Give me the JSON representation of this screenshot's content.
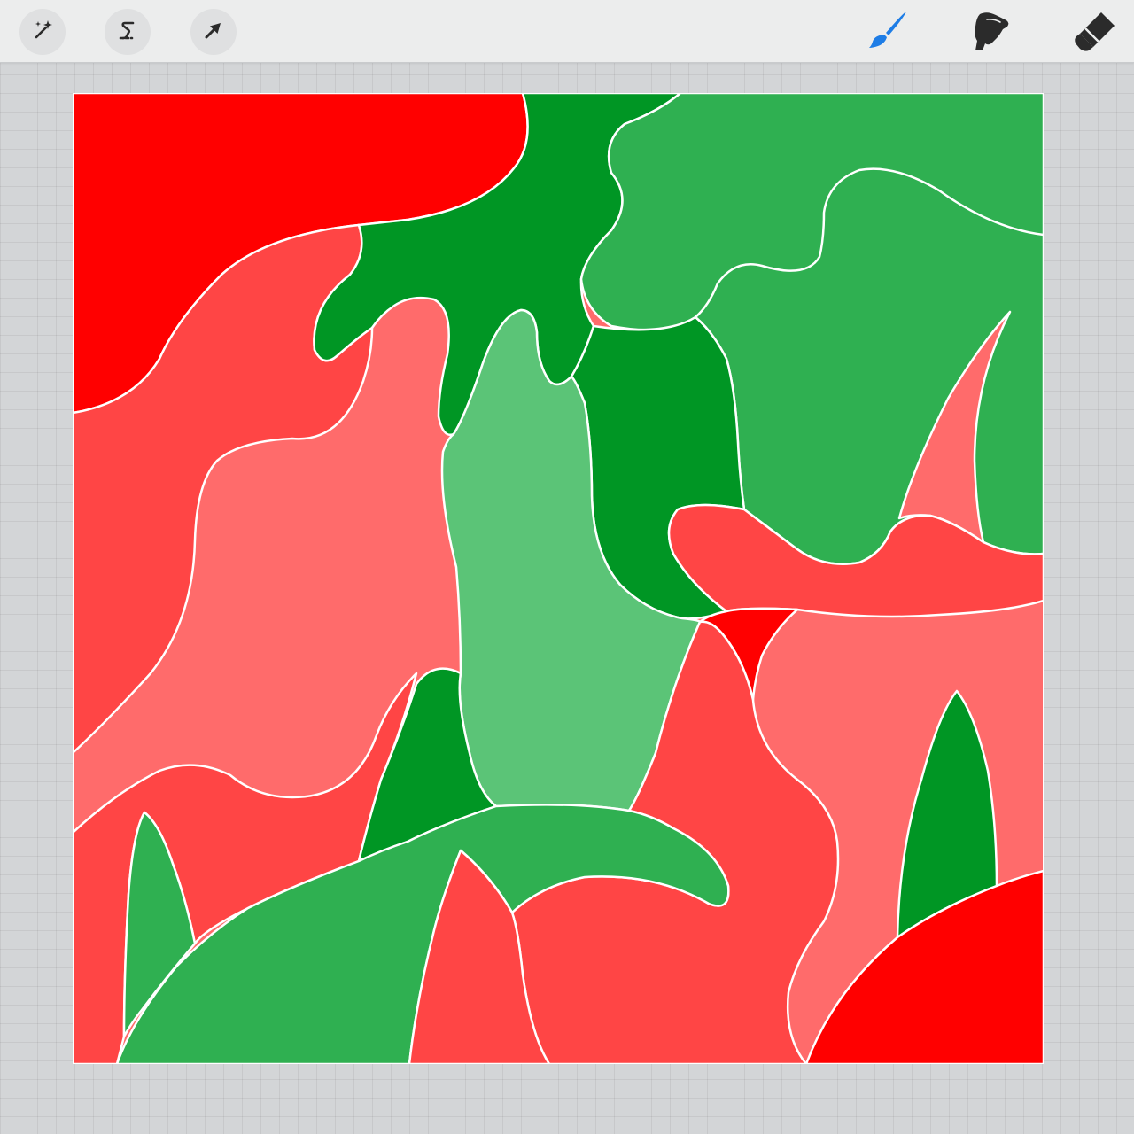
{
  "app": {
    "toolbar": {
      "left_tools": [
        {
          "id": "adjustments",
          "icon": "magic-wand-icon",
          "active": false
        },
        {
          "id": "selection",
          "icon": "selection-s-icon",
          "active": false
        },
        {
          "id": "transform",
          "icon": "arrow-cursor-icon",
          "active": false
        }
      ],
      "right_tools": [
        {
          "id": "brush",
          "icon": "brush-icon",
          "active": true
        },
        {
          "id": "smudge",
          "icon": "smudge-finger-icon",
          "active": false
        },
        {
          "id": "eraser",
          "icon": "eraser-icon",
          "active": false
        }
      ]
    },
    "colors": {
      "active_tool": "#1e7de6",
      "inactive_tool": "#2b2b2b",
      "canvas_bg": "#d3d5d7",
      "toolbar_bg": "#eceded"
    },
    "artwork": {
      "palette": {
        "bright_red": "#ff0000",
        "medium_red": "#ff4545",
        "light_red": "#ff6b6b",
        "dark_green": "#009624",
        "medium_green": "#2fb051",
        "light_green": "#5bc477",
        "outline": "#ffffff"
      }
    }
  }
}
